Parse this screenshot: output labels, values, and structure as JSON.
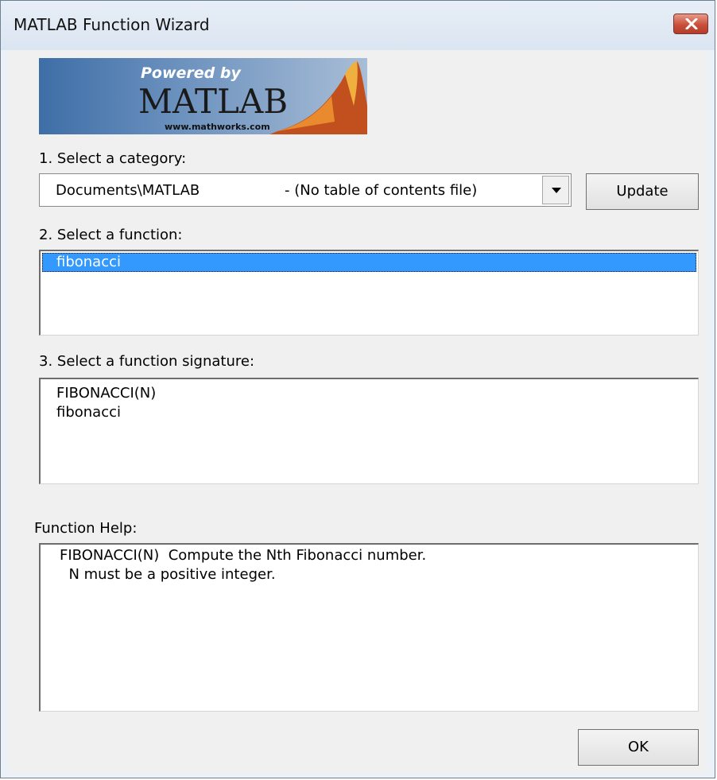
{
  "window": {
    "title": "MATLAB Function Wizard"
  },
  "logo": {
    "powered": "Powered by",
    "brand": "MATLAB",
    "url": "www.mathworks.com"
  },
  "category": {
    "label": "1. Select a category:",
    "selected_path": "Documents\\MATLAB",
    "selected_note": "- (No table of contents file)",
    "update_label": "Update"
  },
  "function": {
    "label": "2. Select a function:",
    "items": [
      "fibonacci"
    ]
  },
  "signature": {
    "label": "3. Select a function signature:",
    "items": [
      "FIBONACCI(N)",
      "fibonacci"
    ]
  },
  "help": {
    "label": "Function Help:",
    "lines": [
      "FIBONACCI(N)  Compute the Nth Fibonacci number.",
      "  N must be a positive integer."
    ]
  },
  "ok_label": "OK"
}
